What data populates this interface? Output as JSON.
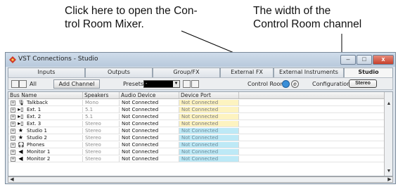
{
  "callouts": {
    "left": [
      "Click here to open the Con-",
      "trol Room Mixer."
    ],
    "right": [
      "The width of the",
      "Control Room channel"
    ]
  },
  "window": {
    "title": "VST Connections - Studio",
    "buttons": {
      "minimize": "–",
      "maximize": "□",
      "close": "x"
    }
  },
  "tabs": [
    "Inputs",
    "Outputs",
    "Group/FX",
    "External FX",
    "External Instruments",
    "Studio"
  ],
  "active_tab": "Studio",
  "toolbar": {
    "all_label": "All",
    "add_channel": "Add Channel",
    "presets_label": "Presets",
    "presets_value": "-",
    "control_room_label": "Control Room:",
    "configuration_label": "Configuration:",
    "configuration_value": "Stereo"
  },
  "columns": [
    "Bus Name",
    "Speakers",
    "Audio Device",
    "Device Port"
  ],
  "rows": [
    {
      "name": "Talkback",
      "icon": "microphone-icon",
      "speakers": "Mono",
      "device": "Not Connected",
      "port": "Not Connected",
      "port_color": "yellow"
    },
    {
      "name": "Ext. 1",
      "icon": "external-input-icon",
      "speakers": "5.1",
      "device": "Not Connected",
      "port": "Not Connected",
      "port_color": "yellow"
    },
    {
      "name": "Ext. 2",
      "icon": "external-input-icon",
      "speakers": "5.1",
      "device": "Not Connected",
      "port": "Not Connected",
      "port_color": "yellow"
    },
    {
      "name": "Ext. 3",
      "icon": "external-input-icon",
      "speakers": "Stereo",
      "device": "Not Connected",
      "port": "Not Connected",
      "port_color": "yellow"
    },
    {
      "name": "Studio 1",
      "icon": "star-icon",
      "speakers": "Stereo",
      "device": "Not Connected",
      "port": "Not Connected",
      "port_color": "cyan"
    },
    {
      "name": "Studio 2",
      "icon": "star-icon",
      "speakers": "Stereo",
      "device": "Not Connected",
      "port": "Not Connected",
      "port_color": "cyan"
    },
    {
      "name": "Phones",
      "icon": "headphones-icon",
      "speakers": "Stereo",
      "device": "Not Connected",
      "port": "Not Connected",
      "port_color": "cyan"
    },
    {
      "name": "Monitor 1",
      "icon": "speaker-icon",
      "speakers": "Stereo",
      "device": "Not Connected",
      "port": "Not Connected",
      "port_color": "cyan"
    },
    {
      "name": "Monitor 2",
      "icon": "speaker-icon",
      "speakers": "Stereo",
      "device": "Not Connected",
      "port": "Not Connected",
      "port_color": "cyan"
    }
  ],
  "colors": {
    "port_yellow": "#fdf3c0",
    "port_cyan": "#bde9f6",
    "accent_blue": "#3a8fd8"
  }
}
